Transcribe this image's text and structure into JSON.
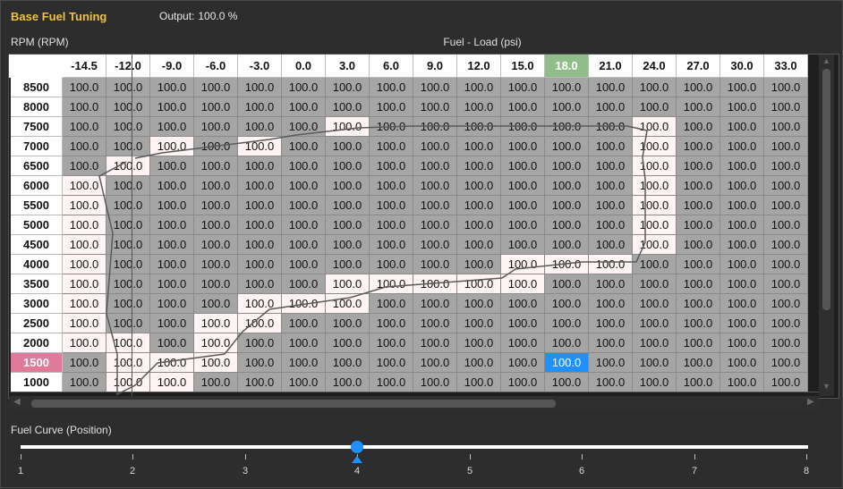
{
  "title": "Base Fuel Tuning",
  "output": {
    "label": "Output:",
    "value": "100.0 %"
  },
  "y_axis_label": "RPM (RPM)",
  "x_axis_label": "Fuel - Load (psi)",
  "table": {
    "columns": [
      "-14.5",
      "-12.0",
      "-9.0",
      "-6.0",
      "-3.0",
      "0.0",
      "3.0",
      "6.0",
      "9.0",
      "12.0",
      "15.0",
      "18.0",
      "21.0",
      "24.0",
      "27.0",
      "30.0",
      "33.0"
    ],
    "highlight_column": "18.0",
    "rows": [
      {
        "rpm": "8500",
        "values": [
          "100.0",
          "100.0",
          "100.0",
          "100.0",
          "100.0",
          "100.0",
          "100.0",
          "100.0",
          "100.0",
          "100.0",
          "100.0",
          "100.0",
          "100.0",
          "100.0",
          "100.0",
          "100.0",
          "100.0"
        ]
      },
      {
        "rpm": "8000",
        "values": [
          "100.0",
          "100.0",
          "100.0",
          "100.0",
          "100.0",
          "100.0",
          "100.0",
          "100.0",
          "100.0",
          "100.0",
          "100.0",
          "100.0",
          "100.0",
          "100.0",
          "100.0",
          "100.0",
          "100.0"
        ]
      },
      {
        "rpm": "7500",
        "values": [
          "100.0",
          "100.0",
          "100.0",
          "100.0",
          "100.0",
          "100.0",
          "100.0",
          "100.0",
          "100.0",
          "100.0",
          "100.0",
          "100.0",
          "100.0",
          "100.0",
          "100.0",
          "100.0",
          "100.0"
        ]
      },
      {
        "rpm": "7000",
        "values": [
          "100.0",
          "100.0",
          "100.0",
          "100.0",
          "100.0",
          "100.0",
          "100.0",
          "100.0",
          "100.0",
          "100.0",
          "100.0",
          "100.0",
          "100.0",
          "100.0",
          "100.0",
          "100.0",
          "100.0"
        ]
      },
      {
        "rpm": "6500",
        "values": [
          "100.0",
          "100.0",
          "100.0",
          "100.0",
          "100.0",
          "100.0",
          "100.0",
          "100.0",
          "100.0",
          "100.0",
          "100.0",
          "100.0",
          "100.0",
          "100.0",
          "100.0",
          "100.0",
          "100.0"
        ]
      },
      {
        "rpm": "6000",
        "values": [
          "100.0",
          "100.0",
          "100.0",
          "100.0",
          "100.0",
          "100.0",
          "100.0",
          "100.0",
          "100.0",
          "100.0",
          "100.0",
          "100.0",
          "100.0",
          "100.0",
          "100.0",
          "100.0",
          "100.0"
        ]
      },
      {
        "rpm": "5500",
        "values": [
          "100.0",
          "100.0",
          "100.0",
          "100.0",
          "100.0",
          "100.0",
          "100.0",
          "100.0",
          "100.0",
          "100.0",
          "100.0",
          "100.0",
          "100.0",
          "100.0",
          "100.0",
          "100.0",
          "100.0"
        ]
      },
      {
        "rpm": "5000",
        "values": [
          "100.0",
          "100.0",
          "100.0",
          "100.0",
          "100.0",
          "100.0",
          "100.0",
          "100.0",
          "100.0",
          "100.0",
          "100.0",
          "100.0",
          "100.0",
          "100.0",
          "100.0",
          "100.0",
          "100.0"
        ]
      },
      {
        "rpm": "4500",
        "values": [
          "100.0",
          "100.0",
          "100.0",
          "100.0",
          "100.0",
          "100.0",
          "100.0",
          "100.0",
          "100.0",
          "100.0",
          "100.0",
          "100.0",
          "100.0",
          "100.0",
          "100.0",
          "100.0",
          "100.0"
        ]
      },
      {
        "rpm": "4000",
        "values": [
          "100.0",
          "100.0",
          "100.0",
          "100.0",
          "100.0",
          "100.0",
          "100.0",
          "100.0",
          "100.0",
          "100.0",
          "100.0",
          "100.0",
          "100.0",
          "100.0",
          "100.0",
          "100.0",
          "100.0"
        ]
      },
      {
        "rpm": "3500",
        "values": [
          "100.0",
          "100.0",
          "100.0",
          "100.0",
          "100.0",
          "100.0",
          "100.0",
          "100.0",
          "100.0",
          "100.0",
          "100.0",
          "100.0",
          "100.0",
          "100.0",
          "100.0",
          "100.0",
          "100.0"
        ]
      },
      {
        "rpm": "3000",
        "values": [
          "100.0",
          "100.0",
          "100.0",
          "100.0",
          "100.0",
          "100.0",
          "100.0",
          "100.0",
          "100.0",
          "100.0",
          "100.0",
          "100.0",
          "100.0",
          "100.0",
          "100.0",
          "100.0",
          "100.0"
        ]
      },
      {
        "rpm": "2500",
        "values": [
          "100.0",
          "100.0",
          "100.0",
          "100.0",
          "100.0",
          "100.0",
          "100.0",
          "100.0",
          "100.0",
          "100.0",
          "100.0",
          "100.0",
          "100.0",
          "100.0",
          "100.0",
          "100.0",
          "100.0"
        ]
      },
      {
        "rpm": "2000",
        "values": [
          "100.0",
          "100.0",
          "100.0",
          "100.0",
          "100.0",
          "100.0",
          "100.0",
          "100.0",
          "100.0",
          "100.0",
          "100.0",
          "100.0",
          "100.0",
          "100.0",
          "100.0",
          "100.0",
          "100.0"
        ]
      },
      {
        "rpm": "1500",
        "values": [
          "100.0",
          "100.0",
          "100.0",
          "100.0",
          "100.0",
          "100.0",
          "100.0",
          "100.0",
          "100.0",
          "100.0",
          "100.0",
          "100.0",
          "100.0",
          "100.0",
          "100.0",
          "100.0",
          "100.0"
        ]
      },
      {
        "rpm": "1000",
        "values": [
          "100.0",
          "100.0",
          "100.0",
          "100.0",
          "100.0",
          "100.0",
          "100.0",
          "100.0",
          "100.0",
          "100.0",
          "100.0",
          "100.0",
          "100.0",
          "100.0",
          "100.0",
          "100.0",
          "100.0"
        ]
      }
    ],
    "highlight_row": "1500",
    "selected_cell": {
      "rpm": "1500",
      "load": "18.0"
    },
    "visited_cells": [
      [
        "7500",
        "3.0"
      ],
      [
        "7500",
        "24.0"
      ],
      [
        "7000",
        "-9.0"
      ],
      [
        "7000",
        "-3.0"
      ],
      [
        "7000",
        "24.0"
      ],
      [
        "6500",
        "-12.0"
      ],
      [
        "6500",
        "24.0"
      ],
      [
        "6000",
        "-14.5"
      ],
      [
        "6000",
        "24.0"
      ],
      [
        "5500",
        "-14.5"
      ],
      [
        "5500",
        "24.0"
      ],
      [
        "5000",
        "-14.5"
      ],
      [
        "5000",
        "24.0"
      ],
      [
        "4500",
        "-14.5"
      ],
      [
        "4500",
        "24.0"
      ],
      [
        "4000",
        "-14.5"
      ],
      [
        "4000",
        "15.0"
      ],
      [
        "4000",
        "18.0"
      ],
      [
        "4000",
        "21.0"
      ],
      [
        "3500",
        "-14.5"
      ],
      [
        "3500",
        "3.0"
      ],
      [
        "3500",
        "6.0"
      ],
      [
        "3500",
        "9.0"
      ],
      [
        "3500",
        "12.0"
      ],
      [
        "3500",
        "15.0"
      ],
      [
        "3000",
        "-14.5"
      ],
      [
        "3000",
        "-3.0"
      ],
      [
        "3000",
        "0.0"
      ],
      [
        "3000",
        "3.0"
      ],
      [
        "2500",
        "-14.5"
      ],
      [
        "2500",
        "-6.0"
      ],
      [
        "2500",
        "-3.0"
      ],
      [
        "2000",
        "-14.5"
      ],
      [
        "2000",
        "-12.0"
      ],
      [
        "2000",
        "-6.0"
      ],
      [
        "1500",
        "-12.0"
      ],
      [
        "1500",
        "-9.0"
      ],
      [
        "1500",
        "-6.0"
      ],
      [
        "1000",
        "-12.0"
      ],
      [
        "1000",
        "-9.0"
      ]
    ]
  },
  "fuel_curve": {
    "label": "Fuel Curve  (Position)",
    "ticks": [
      "1",
      "2",
      "3",
      "4",
      "5",
      "6",
      "7",
      "8"
    ],
    "position": 4
  },
  "colors": {
    "accent": "#1e90ff",
    "title": "#f0c040",
    "col_highlight": "#8fbe8a",
    "row_highlight": "#e07a9a"
  }
}
